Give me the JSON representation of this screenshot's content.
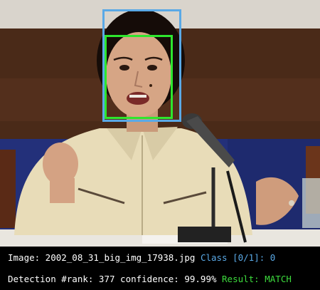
{
  "colors": {
    "ground_truth_box": "#5aa9e6",
    "detection_box": "#2ee62e",
    "label_white": "#ffffff",
    "label_blue": "#5aa9e6",
    "label_green": "#3ddc3d"
  },
  "info": {
    "line1": {
      "image_label": "Image: 2002_08_31_big_img_17938.jpg",
      "class_label": "Class [0/1]: 0"
    },
    "line2": {
      "detection_label": "Detection #rank: 377 confidence: 99.99%",
      "result_label": "Result: MATCH"
    }
  }
}
